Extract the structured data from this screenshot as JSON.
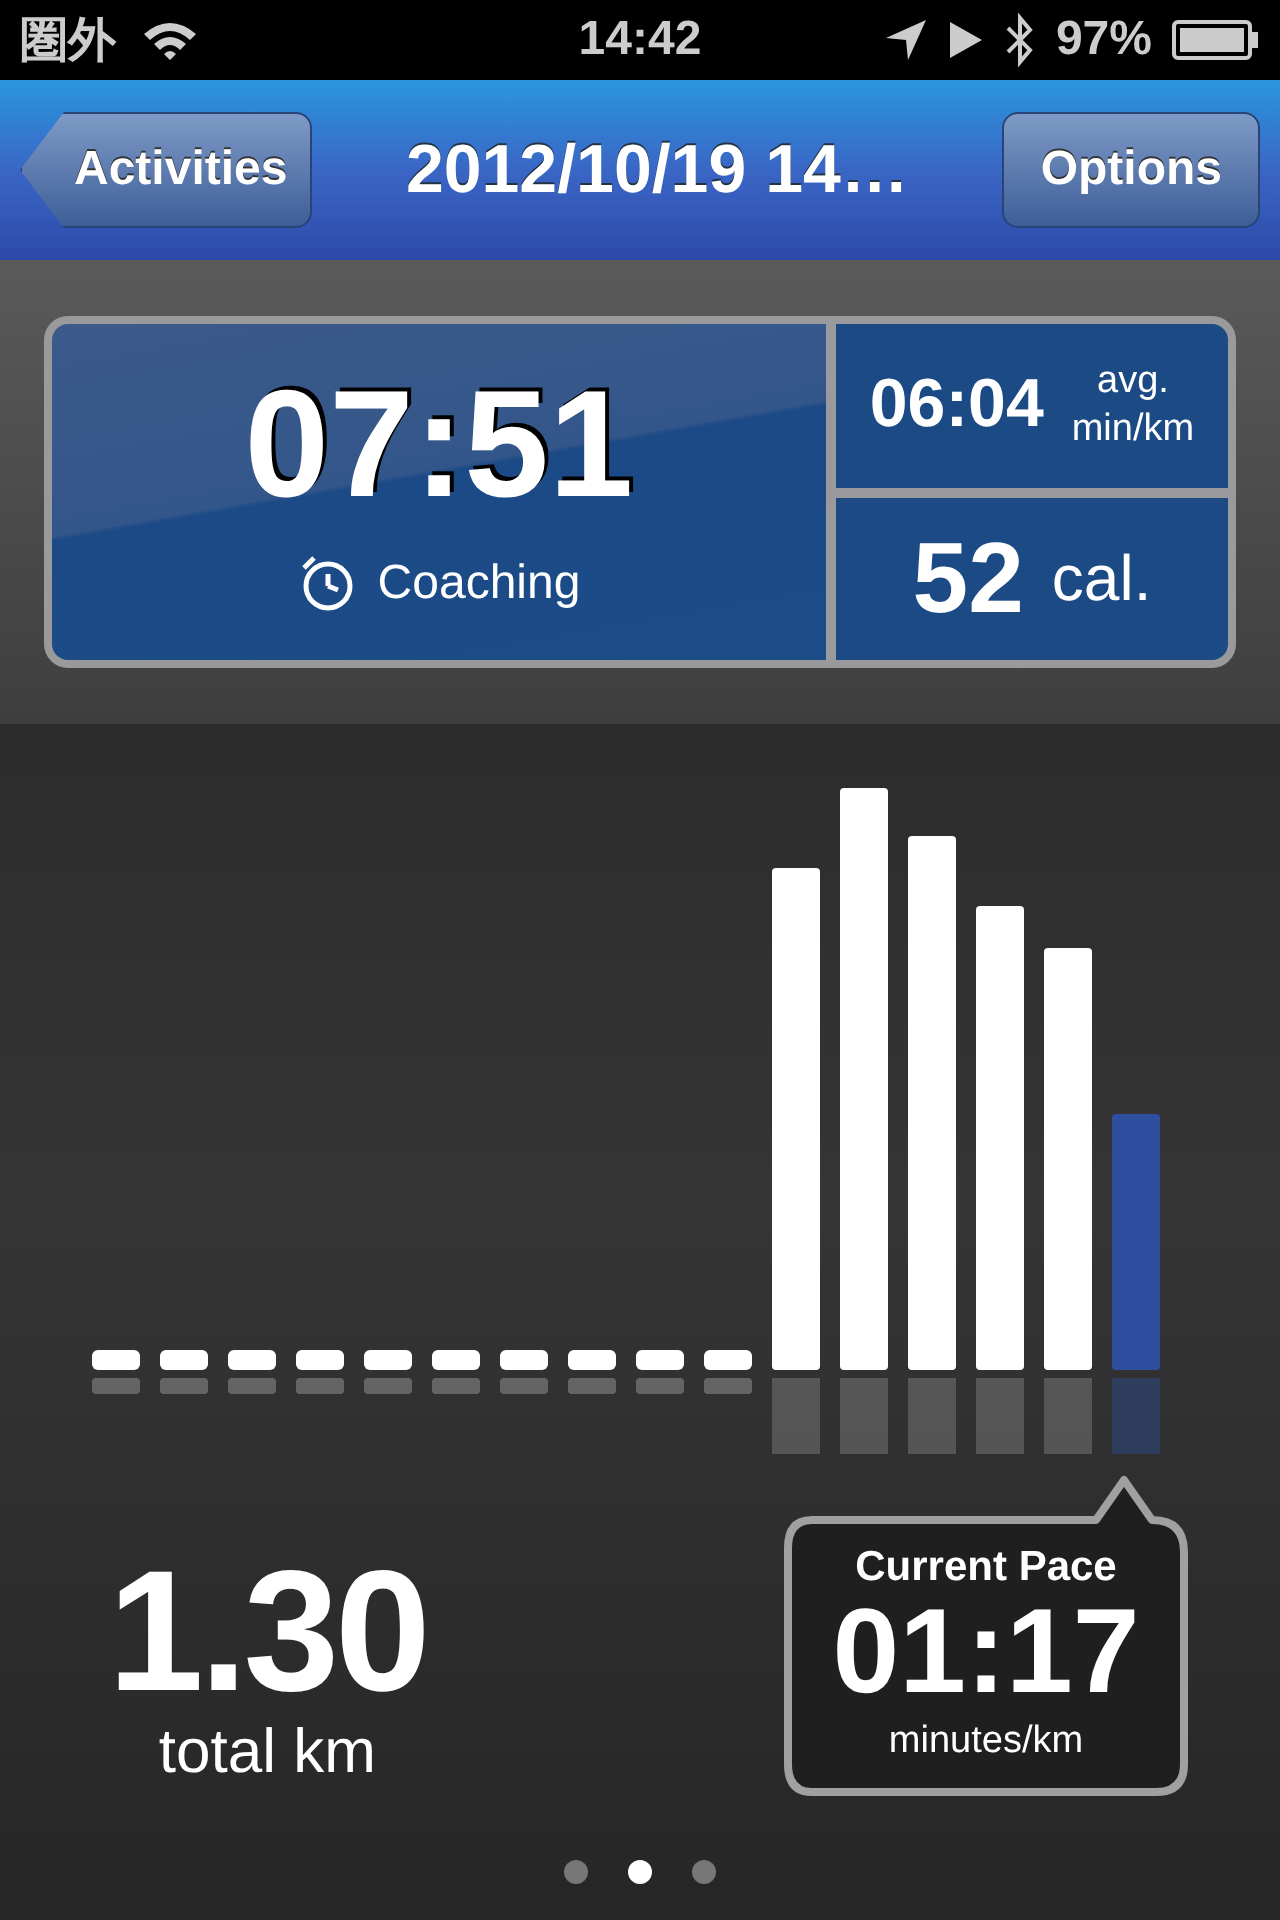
{
  "status_bar": {
    "carrier": "圏外",
    "time": "14:42",
    "battery": "97%"
  },
  "nav_bar": {
    "back_button": "Activities",
    "title": "2012/10/19 14…",
    "right_button": "Options"
  },
  "summary": {
    "duration": "07:51",
    "coaching": "Coaching",
    "avg_pace": "06:04",
    "avg_pace_unit_1": "avg.",
    "avg_pace_unit_2": "min/km",
    "calories": "52",
    "calories_unit": "cal."
  },
  "distance": {
    "value": "1.30",
    "unit": "total km"
  },
  "current_pace": {
    "label": "Current Pace",
    "value": "01:17",
    "unit": "minutes/km"
  },
  "page_dots": [
    {
      "selected": false
    },
    {
      "selected": true
    },
    {
      "selected": false
    }
  ]
}
